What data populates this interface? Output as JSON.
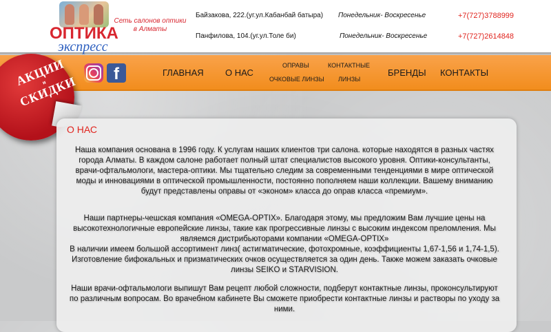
{
  "logo": {
    "title": "ОПТИКА",
    "subtitle": "экспресс",
    "tagline": "Сеть салонов оптики в Алматы"
  },
  "locations": [
    {
      "address": "Байзакова, 222.(уг.ул.Кабанбай батыра)",
      "hours": "Понедельник- Воскресенье",
      "phone": "+7(727)3788999"
    },
    {
      "address": "Панфилова, 104.(уг.ул.Толе би)",
      "hours": "Понедельник- Воскресенье",
      "phone": "+7(727)2614848"
    }
  ],
  "badge": {
    "line1": "АКЦИИ",
    "line2": "и",
    "line3": "СКИДКИ"
  },
  "social": {
    "instagram": "instagram-icon",
    "facebook": "facebook-icon"
  },
  "nav": {
    "home": "ГЛАВНАЯ",
    "about": "О НАС",
    "frames": "ОПРАВЫ",
    "sunglasses": "ОЧКОВЫЕ ЛИНЗЫ",
    "contact_lenses_1": "КОНТАКТНЫЕ",
    "contact_lenses_2": "ЛИНЗЫ",
    "brands": "БРЕНДЫ",
    "contacts": "КОНТАКТЫ"
  },
  "content": {
    "title": "О НАС",
    "p1": "Наша компания основана в 1996 году. К услугам наших клиентов три салона. которые находятся в разных частях города Алматы. В каждом салоне работает полный штат специалистов высокого уровня. Оптики-консультанты, врачи-офтальмологи, мастера-оптики. Мы тщательно следим за современными тенденциями в мире оптической моды и инновациями в оптической промышленности, постоянно пополняем наши коллекции. Вашему вниманию будут представлены оправы от «эконом» класса до оправ класса «премиум».",
    "p2a": "Наши партнеры-чешская компания «OMEGA-OPTIX». Благодаря этому, мы предложим Вам лучшие цены на высокотехнологичные европейские линзы, такие как прогрессивные линзы с высоким индексом преломления. Мы являемся дистрибьюторами компании «OMEGA-OPTIX»",
    "p2b": "В наличии имеем большой ассортимент линз( астигматические, фотохромные, коэффициенты 1,67-1,56 и 1,74-1,5). Изготовление бифокальных и призматических очков осуществляется за один день. Также можем заказать очковые линзы SEIKO и STARVISION.",
    "p3": "Наши врачи-офтальмологи выпишут Вам рецепт любой сложности, подберут контактные линзы, проконсультируют по различным вопросам. Во врачебном кабинете Вы сможете приобрести контактные линзы и растворы по уходу за ними."
  }
}
